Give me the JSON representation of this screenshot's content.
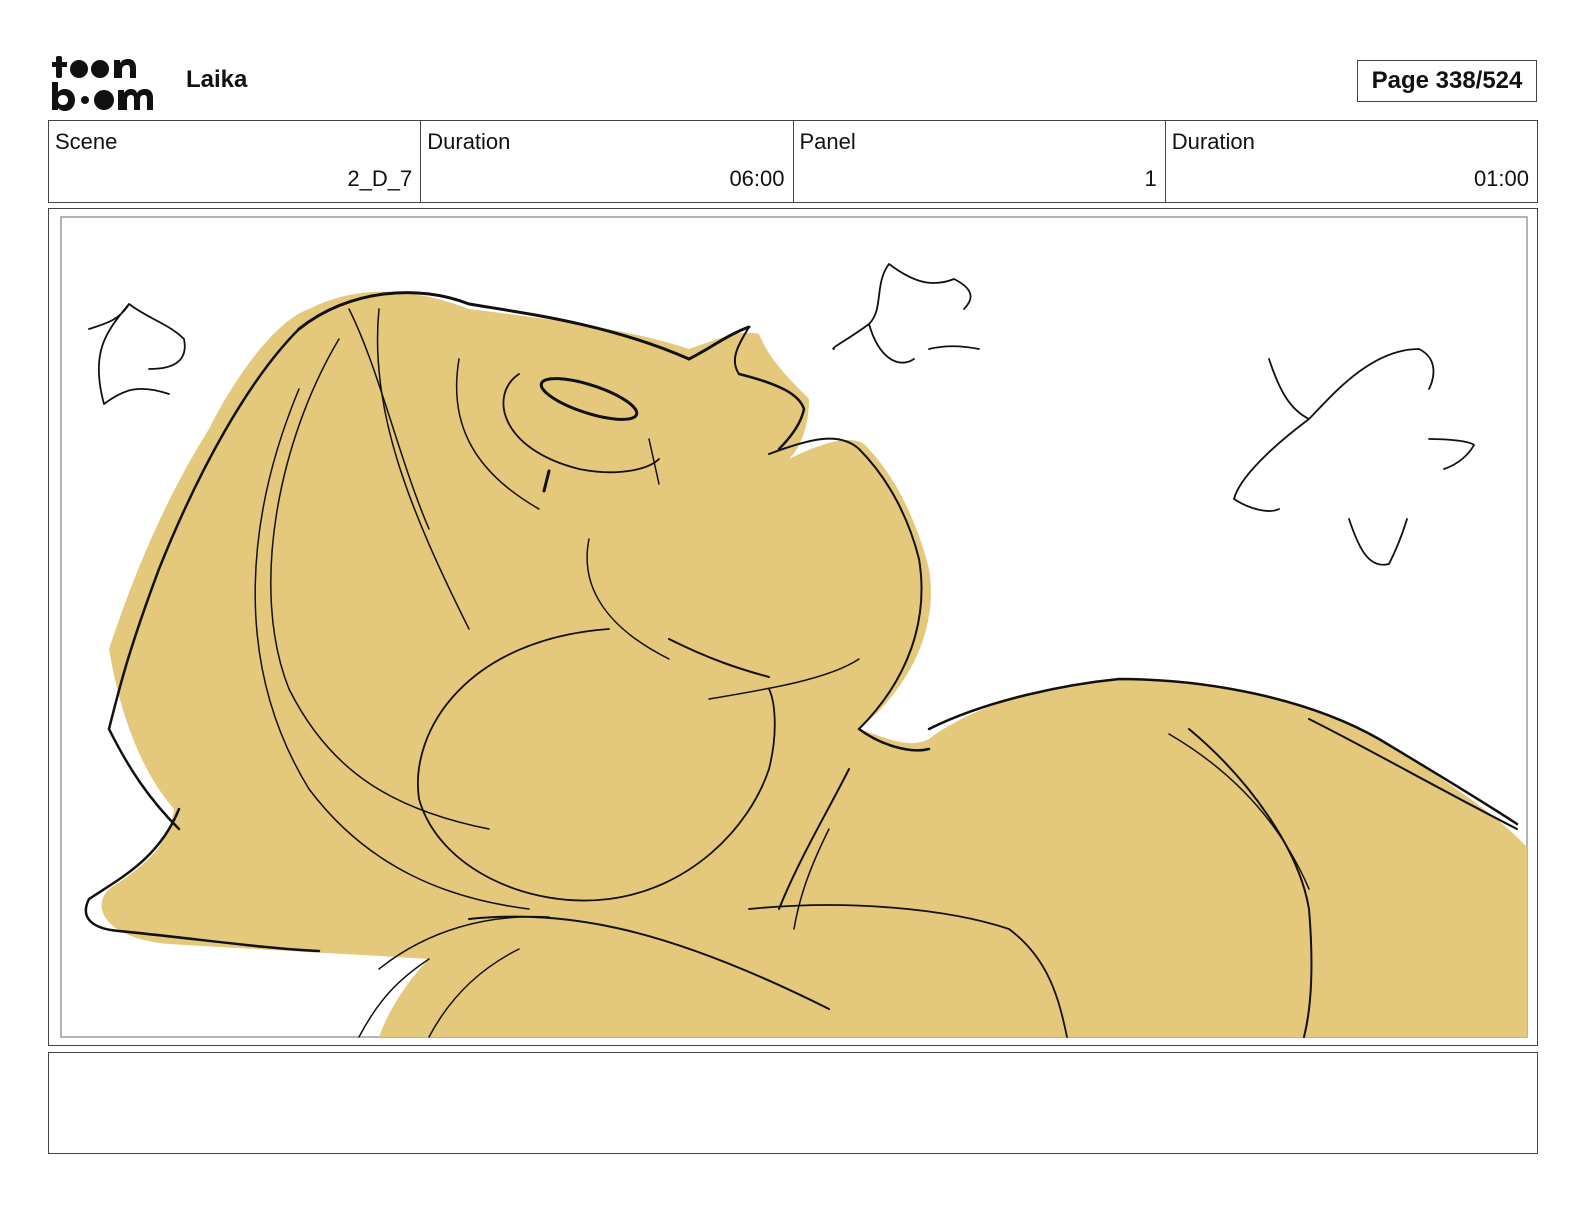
{
  "header": {
    "logo_text_top": "toon",
    "logo_text_bottom": "boom",
    "project_title": "Laika",
    "page_label": "Page 338/524"
  },
  "info": [
    {
      "label": "Scene",
      "value": "2_D_7"
    },
    {
      "label": "Duration",
      "value": "06:00"
    },
    {
      "label": "Panel",
      "value": "1"
    },
    {
      "label": "Duration",
      "value": "01:00"
    }
  ],
  "panel": {
    "fill_color": "#e4c87c",
    "line_color": "#111111"
  },
  "notes": {
    "text": ""
  }
}
